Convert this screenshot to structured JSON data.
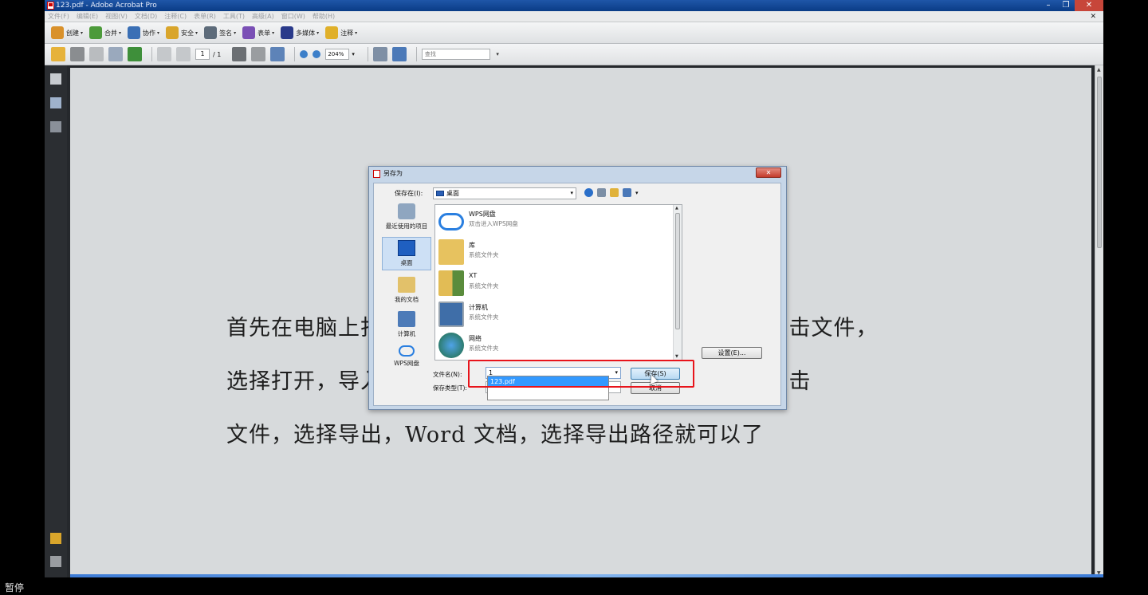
{
  "window": {
    "title": "123.pdf - Adobe Acrobat Pro",
    "controls": {
      "minimize": "–",
      "restore": "❐",
      "close": "✕"
    }
  },
  "menubar": {
    "items": [
      "文件(F)",
      "编辑(E)",
      "视图(V)",
      "文档(D)",
      "注释(C)",
      "表单(R)",
      "工具(T)",
      "高级(A)",
      "窗口(W)",
      "帮助(H)"
    ],
    "doc_close": "✕"
  },
  "toolbar1": {
    "buttons": [
      {
        "label": "创建",
        "icon": "create-icon",
        "color": "#d9912b"
      },
      {
        "label": "合并",
        "icon": "combine-icon",
        "color": "#4c9a3a"
      },
      {
        "label": "协作",
        "icon": "collaborate-icon",
        "color": "#3a6fb5"
      },
      {
        "label": "安全",
        "icon": "lock-icon",
        "color": "#d9a52b"
      },
      {
        "label": "签名",
        "icon": "pen-icon",
        "color": "#5d6b7a"
      },
      {
        "label": "表单",
        "icon": "form-icon",
        "color": "#7a4fb5"
      },
      {
        "label": "多媒体",
        "icon": "multimedia-icon",
        "color": "#2a3a8a"
      },
      {
        "label": "注释",
        "icon": "comment-icon",
        "color": "#e0b02a"
      }
    ]
  },
  "toolbar2": {
    "page_number": "1",
    "page_total": "/ 1",
    "zoom": "204%",
    "find_placeholder": "查找"
  },
  "document": {
    "lines": [
      "首先在电脑上打开迅捷PDF转换器软件，然后在左上角点击文件，",
      "选择打开，导入需要转换的PDF文件，点击开始，再次点击",
      "文件，选择导出，Word 文档，选择导出路径就可以了"
    ]
  },
  "dialog": {
    "title": "另存为",
    "save_in_label": "保存在(I):",
    "save_in_value": "桌面",
    "places": [
      {
        "label": "最近使用的项目",
        "icon": "recent-icon"
      },
      {
        "label": "桌面",
        "icon": "desktop-icon",
        "selected": true
      },
      {
        "label": "我的文档",
        "icon": "documents-icon"
      },
      {
        "label": "计算机",
        "icon": "computer-icon"
      },
      {
        "label": "WPS网盘",
        "icon": "cloud-icon"
      }
    ],
    "files": [
      {
        "name": "WPS网盘",
        "desc": "双击进入WPS网盘",
        "icon": "cloud-icon"
      },
      {
        "name": "库",
        "desc": "系统文件夹",
        "icon": "library-folder-icon"
      },
      {
        "name": "XT",
        "desc": "系统文件夹",
        "icon": "user-folder-icon"
      },
      {
        "name": "计算机",
        "desc": "系统文件夹",
        "icon": "computer-icon"
      },
      {
        "name": "网络",
        "desc": "系统文件夹",
        "icon": "network-icon"
      }
    ],
    "settings_label": "设置(E)...",
    "filename_label": "文件名(N):",
    "filename_value": "1",
    "filetype_label": "保存类型(T):",
    "autocomplete_item": "123.pdf",
    "save_label": "保存(S)",
    "cancel_label": "取消",
    "close_label": "✕"
  },
  "overlay": {
    "pause_text": "暂停",
    "highlight_color": "#e8141b"
  }
}
